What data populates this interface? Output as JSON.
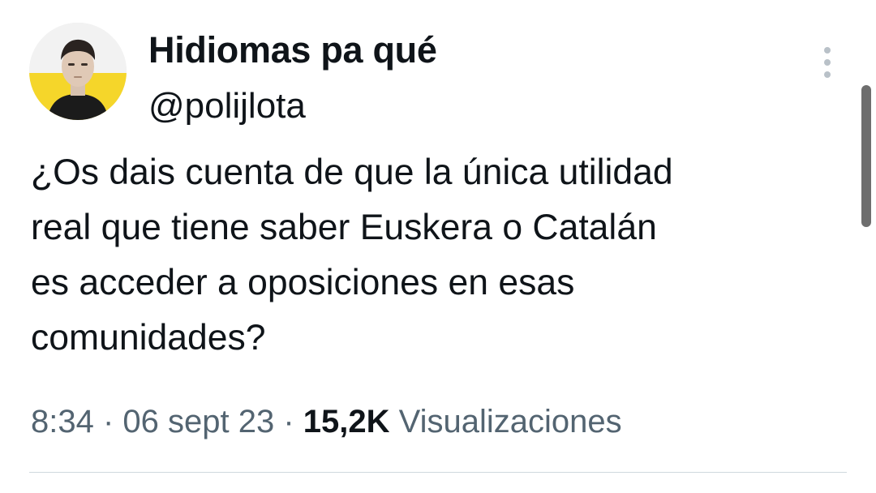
{
  "author": {
    "display_name": "Hidiomas pa qué",
    "handle": "@polijlota",
    "avatar": "avatar-portrait"
  },
  "menu": {
    "icon": "more-vertical-icon"
  },
  "tweet": {
    "lines": [
      "¿Os dais cuenta de que la única utilidad",
      "real que tiene saber Euskera o Catalán",
      "es acceder a oposiciones en esas",
      "comunidades?"
    ]
  },
  "meta": {
    "time": "8:34",
    "separator_1": " · ",
    "date": "06 sept 23",
    "separator_2": " · ",
    "views_count": "15,2K",
    "views_label": " Visualizaciones"
  },
  "colors": {
    "text_primary": "#0f1419",
    "text_secondary": "#536471",
    "divider": "#cfd9de",
    "avatar_banner": "#f5d62a"
  }
}
